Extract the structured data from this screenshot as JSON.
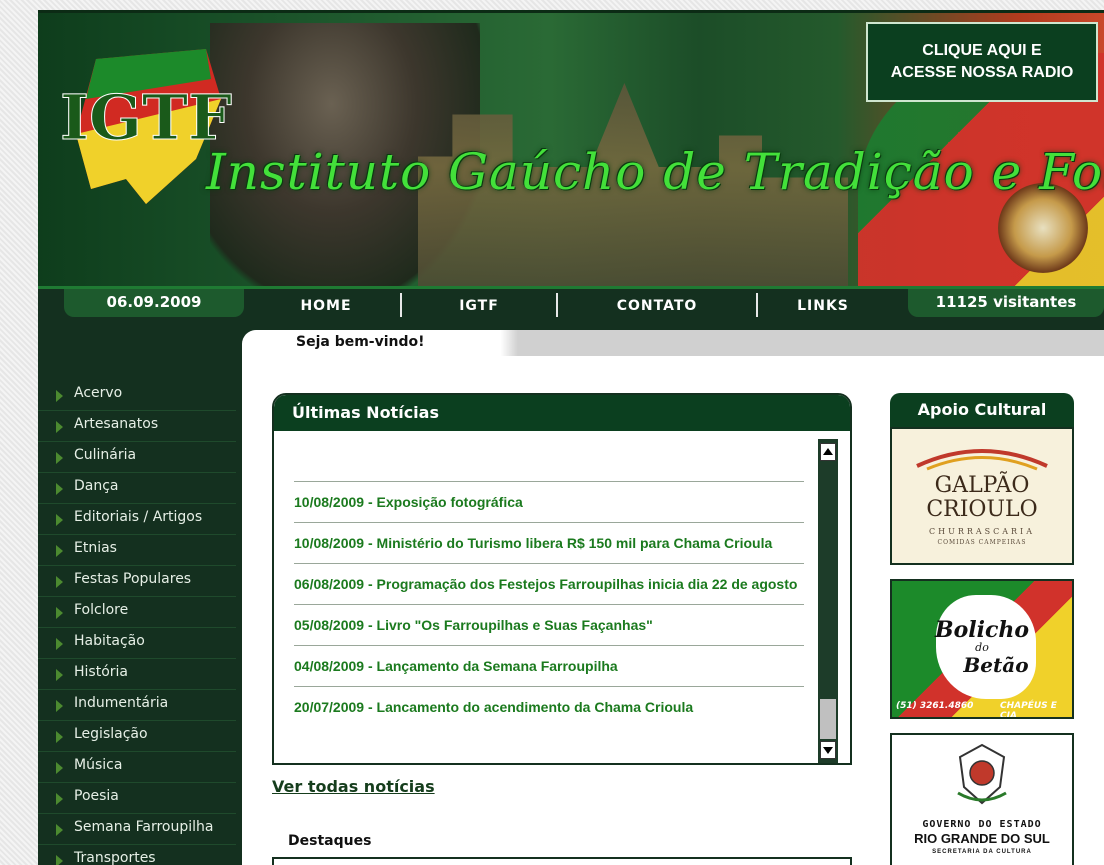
{
  "banner": {
    "logo_text": "IGTF",
    "site_title": "Instituto Gaúcho de Tradição e Folclore",
    "radio_button": "CLIQUE AQUI E\nACESSE NOSSA RADIO"
  },
  "nav": {
    "date": "06.09.2009",
    "visitors": "11125 visitantes",
    "menu": [
      "HOME",
      "IGTF",
      "CONTATO",
      "LINKS"
    ],
    "welcome": "Seja bem-vindo!"
  },
  "sidebar": {
    "items": [
      "Acervo",
      "Artesanatos",
      "Culinária",
      "Dança",
      "Editoriais / Artigos",
      "Etnias",
      "Festas Populares",
      "Folclore",
      "Habitação",
      "História",
      "Indumentária",
      "Legislação",
      "Música",
      "Poesia",
      "Semana Farroupilha",
      "Transportes"
    ]
  },
  "news": {
    "title": "Últimas Notícias",
    "items": [
      {
        "date": "10/08/2009",
        "title": "Exposição fotográfica"
      },
      {
        "date": "10/08/2009",
        "title": "Ministério do Turismo libera R$ 150 mil para Chama Crioula"
      },
      {
        "date": "06/08/2009",
        "title": "Programação dos Festejos Farroupilhas inicia dia 22 de agosto"
      },
      {
        "date": "05/08/2009",
        "title": "Livro \"Os Farroupilhas e Suas Façanhas\""
      },
      {
        "date": "04/08/2009",
        "title": "Lançamento da Semana Farroupilha"
      },
      {
        "date": "20/07/2009",
        "title": "Lancamento do acendimento da Chama Crioula"
      }
    ],
    "more_link": "Ver todas notícias",
    "highlights_title": "Destaques"
  },
  "sponsors": {
    "title": "Apoio Cultural",
    "galpao_1": "GALPÃO",
    "galpao_2": "CRIOULO",
    "galpao_3": "CHURRASCARIA",
    "galpao_4": "COMIDAS CAMPEIRAS",
    "bolicho_1": "Bolicho",
    "bolicho_2": "do",
    "bolicho_3": "Betão",
    "bolicho_phone": "(51) 3261.4860",
    "bolicho_tag": "CHAPÉUS E CIA",
    "gov_1": "GOVERNO DO ESTADO",
    "gov_2": "RIO GRANDE DO SUL",
    "gov_3": "SECRETARIA DA CULTURA"
  },
  "colors": {
    "dark_green": "#14301f",
    "header_green": "#0b3f1f",
    "link_green": "#1b7a1e",
    "title_green": "#43e03a"
  }
}
